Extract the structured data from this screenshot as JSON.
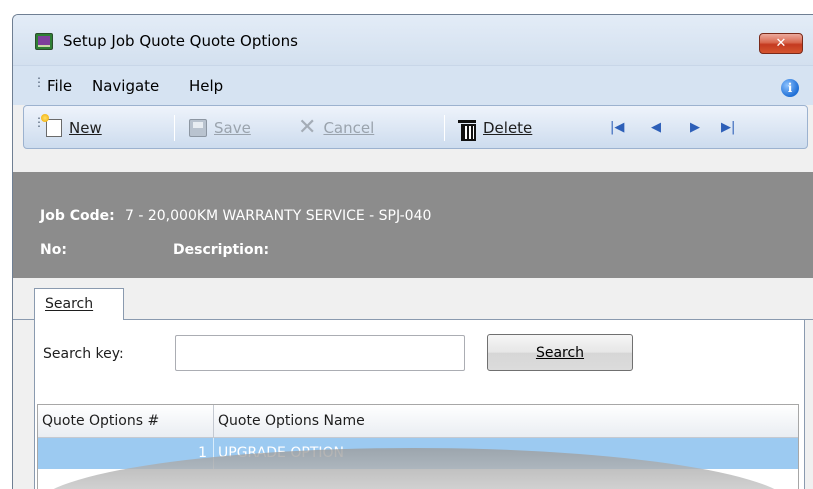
{
  "window": {
    "title": "Setup Job Quote Quote Options",
    "close_glyph": "✕"
  },
  "menu": {
    "items": [
      "File",
      "Navigate",
      "Help"
    ],
    "info_glyph": "i"
  },
  "toolbar": {
    "new_label": "New",
    "save_label": "Save",
    "cancel_label": "Cancel",
    "delete_label": "Delete",
    "cancel_glyph": "✕",
    "nav_first": "|◀",
    "nav_prev": "◀",
    "nav_next": "▶",
    "nav_last": "▶|"
  },
  "header": {
    "job_code_label": "Job Code:",
    "job_code_value": "7 - 20,000KM WARRANTY SERVICE - SPJ-040",
    "no_label": "No:",
    "description_label": "Description:"
  },
  "tabs": [
    {
      "label": "Search"
    }
  ],
  "search": {
    "key_label": "Search key:",
    "input_value": "",
    "button_label": "Search"
  },
  "grid": {
    "columns": [
      "Quote Options #",
      "Quote Options Name"
    ],
    "rows": [
      {
        "number": "1",
        "name": "UPGRADE OPTION"
      }
    ]
  },
  "colors": {
    "selected_row": "#9ccaf1",
    "header_panel": "#8c8c8c",
    "menubar": "#d6e3f2",
    "accent_blue": "#2d5fb8"
  },
  "icons": [
    "app-icon",
    "close-icon",
    "info-icon",
    "new-icon",
    "save-icon",
    "cancel-icon",
    "delete-icon",
    "first-record-icon",
    "prev-record-icon",
    "next-record-icon",
    "last-record-icon"
  ]
}
